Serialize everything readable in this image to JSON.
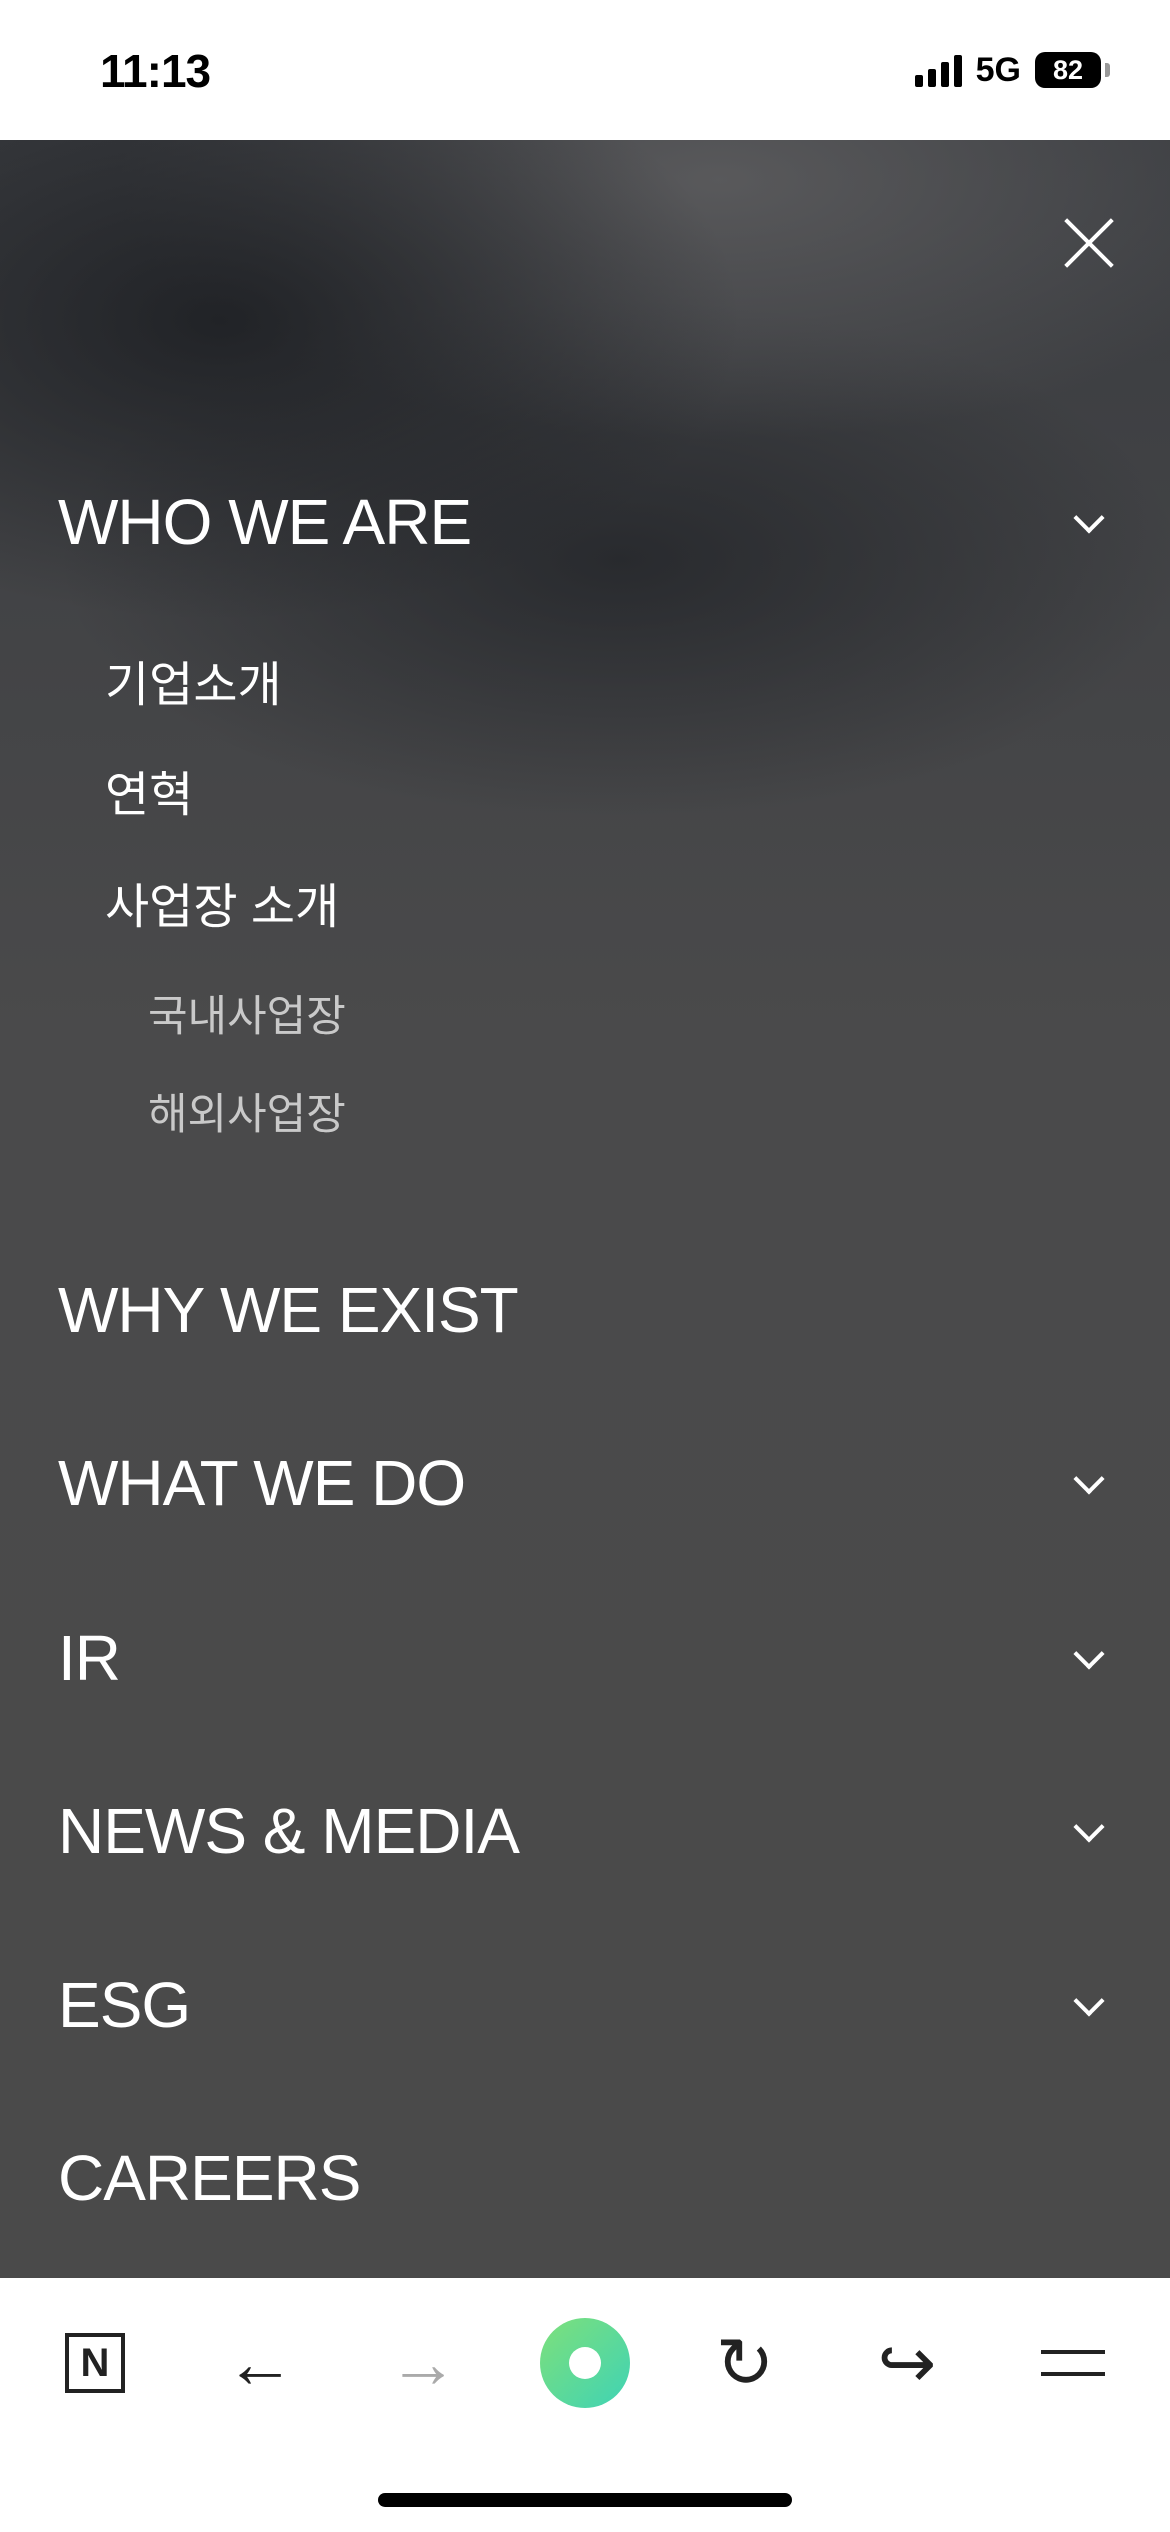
{
  "status_bar": {
    "time": "11:13",
    "network": "5G",
    "battery": "82"
  },
  "menu": {
    "items": [
      {
        "label": "WHO WE ARE",
        "expandable": true
      },
      {
        "label": "WHY WE EXIST",
        "expandable": false
      },
      {
        "label": "WHAT WE DO",
        "expandable": true
      },
      {
        "label": "IR",
        "expandable": true
      },
      {
        "label": "NEWS & MEDIA",
        "expandable": true
      },
      {
        "label": "ESG",
        "expandable": true
      },
      {
        "label": "CAREERS",
        "expandable": false
      }
    ],
    "who_we_are_children": [
      {
        "label": "기업소개"
      },
      {
        "label": "연혁"
      },
      {
        "label": "사업장 소개",
        "children": [
          {
            "label": "국내사업장"
          },
          {
            "label": "해외사업장"
          }
        ]
      }
    ]
  },
  "toolbar": {
    "buttons": [
      {
        "icon": "naver-n-icon",
        "glyph": "N"
      },
      {
        "icon": "back-arrow-icon",
        "glyph": "←"
      },
      {
        "icon": "forward-arrow-icon",
        "glyph": "→",
        "disabled": true
      },
      {
        "icon": "green-dot-icon"
      },
      {
        "icon": "refresh-icon",
        "glyph": "↻"
      },
      {
        "icon": "share-icon",
        "glyph": "↪"
      },
      {
        "icon": "menu-icon"
      }
    ]
  },
  "colors": {
    "panel": "#4a4a4a",
    "text": "#ffffff",
    "subsub_text": "#c9c9c9",
    "accent_green": "#5cd89a"
  }
}
